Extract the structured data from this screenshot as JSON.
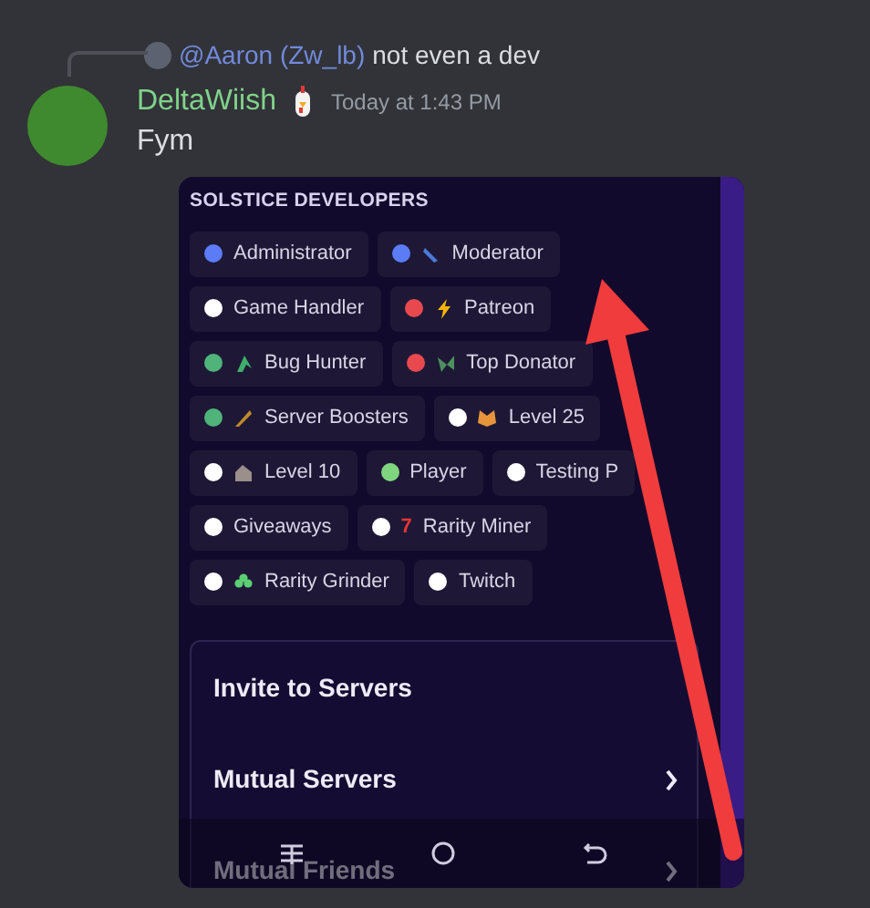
{
  "reply": {
    "author": "@Aaron (Zw_lb)",
    "text": "not even a dev"
  },
  "message": {
    "author": "DeltaWiish",
    "timestamp": "Today at 1:43 PM",
    "text": "Fym"
  },
  "attachment": {
    "section_title": "SOLSTICE DEVELOPERS",
    "role_rows": [
      [
        {
          "name": "Administrator",
          "color": "#5b7cf6",
          "kind": "plain"
        },
        {
          "name": "Moderator",
          "color": "#5b7cf6",
          "kind": "crystal"
        }
      ],
      [
        {
          "name": "Game Handler",
          "color": "#ffffff",
          "kind": "plain"
        },
        {
          "name": "Patreon",
          "color": "#e8494f",
          "kind": "bolt"
        }
      ],
      [
        {
          "name": "Bug Hunter",
          "color": "#4fb37a",
          "kind": "sprout"
        },
        {
          "name": "Top Donator",
          "color": "#e8494f",
          "kind": "leaves"
        }
      ],
      [
        {
          "name": "Server Boosters",
          "color": "#4fb37a",
          "kind": "feather"
        },
        {
          "name": "Level 25",
          "color": "#ffffff",
          "kind": "fox"
        }
      ],
      [
        {
          "name": "Level 10",
          "color": "#ffffff",
          "kind": "house"
        },
        {
          "name": "Player",
          "color": "#7fd67f",
          "kind": "plain"
        },
        {
          "name": "Testing P",
          "color": "#ffffff",
          "kind": "plain"
        }
      ],
      [
        {
          "name": "Giveaways",
          "color": "#ffffff",
          "kind": "plain"
        },
        {
          "name": "Rarity Miner",
          "color": "#ffffff",
          "kind": "digit",
          "emoji": "7"
        }
      ],
      [
        {
          "name": "Rarity Grinder",
          "color": "#ffffff",
          "kind": "clover"
        },
        {
          "name": "Twitch",
          "color": "#ffffff",
          "kind": "plain"
        }
      ]
    ],
    "menu_items": [
      {
        "label": "Invite to Servers",
        "chevron": false
      },
      {
        "label": "Mutual Servers",
        "chevron": true
      },
      {
        "label": "Mutual Friends",
        "chevron": true
      }
    ]
  }
}
